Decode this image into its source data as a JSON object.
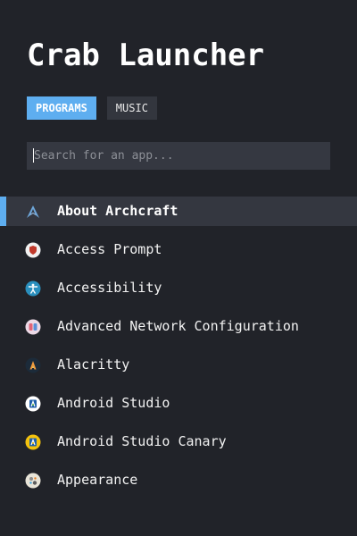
{
  "app": {
    "title": "Crab Launcher"
  },
  "tabs": [
    {
      "label": "PROGRAMS",
      "active": true
    },
    {
      "label": "MUSIC",
      "active": false
    }
  ],
  "search": {
    "value": "",
    "placeholder": "Search for an app..."
  },
  "apps": [
    {
      "label": "About Archcraft",
      "icon": "archcraft-icon",
      "selected": true
    },
    {
      "label": "Access Prompt",
      "icon": "shield-icon",
      "selected": false
    },
    {
      "label": "Accessibility",
      "icon": "accessibility-icon",
      "selected": false
    },
    {
      "label": "Advanced Network Configuration",
      "icon": "network-icon",
      "selected": false
    },
    {
      "label": "Alacritty",
      "icon": "alacritty-icon",
      "selected": false
    },
    {
      "label": "Android Studio",
      "icon": "android-studio-icon",
      "selected": false
    },
    {
      "label": "Android Studio Canary",
      "icon": "android-studio-canary-icon",
      "selected": false
    },
    {
      "label": "Appearance",
      "icon": "appearance-icon",
      "selected": false
    }
  ],
  "colors": {
    "background": "#212329",
    "accent": "#5eaef0",
    "selected_row": "#343740",
    "search_bg": "#353841",
    "inactive_tab": "#33363e"
  }
}
